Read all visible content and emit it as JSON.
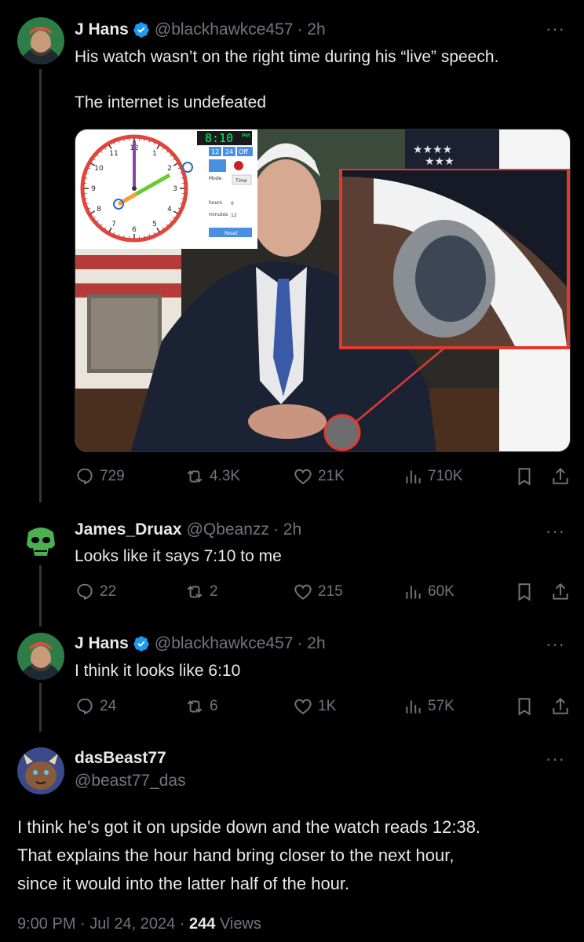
{
  "posts": [
    {
      "name": "J Hans",
      "handle": "@blackhawkce457",
      "time": "· 2h",
      "text1": "His watch wasn’t on the right time during his “live” speech.",
      "text2": "The internet is undefeated",
      "replies": "729",
      "reposts": "4.3K",
      "likes": "21K",
      "views": "710K"
    },
    {
      "name": "James_Druax",
      "handle": "@Qbeanzz",
      "time": "· 2h",
      "text": "Looks like it says 7:10 to me",
      "replies": "22",
      "reposts": "2",
      "likes": "215",
      "views": "60K"
    },
    {
      "name": "J Hans",
      "handle": "@blackhawkce457",
      "time": "· 2h",
      "text": "I think it looks like 6:10",
      "replies": "24",
      "reposts": "6",
      "likes": "1K",
      "views": "57K"
    }
  ],
  "main_post": {
    "name": "dasBeast77",
    "handle": "@beast77_das",
    "text_lines": [
      "I think he's got it on upside down and the watch reads 12:38.",
      "That explains the hour hand bring closer to the next hour,",
      "since it would into the latter half of the hour."
    ],
    "time": "9:00 PM · Jul 24, 2024 · ",
    "views_count": "244",
    "views_label": " Views"
  },
  "media": {
    "clock_digital": "8:10",
    "clock_pm": "PM",
    "clock_12": "12",
    "clock_24": "24",
    "clock_off": "Off",
    "clock_mode": "Mode",
    "clock_time": "Time",
    "clock_hours": "hours",
    "clock_hours_val": "0",
    "clock_minutes": "minutes",
    "clock_minutes_val": "12",
    "clock_reset": "Reset",
    "clock_numbers": [
      "12",
      "1",
      "2",
      "3",
      "4",
      "5",
      "6",
      "7",
      "8",
      "9",
      "10",
      "11"
    ]
  },
  "more_label": "···",
  "colors": {
    "accent": "#1d9bf0",
    "muted": "#71767b",
    "highlight": "#e03a2f"
  }
}
